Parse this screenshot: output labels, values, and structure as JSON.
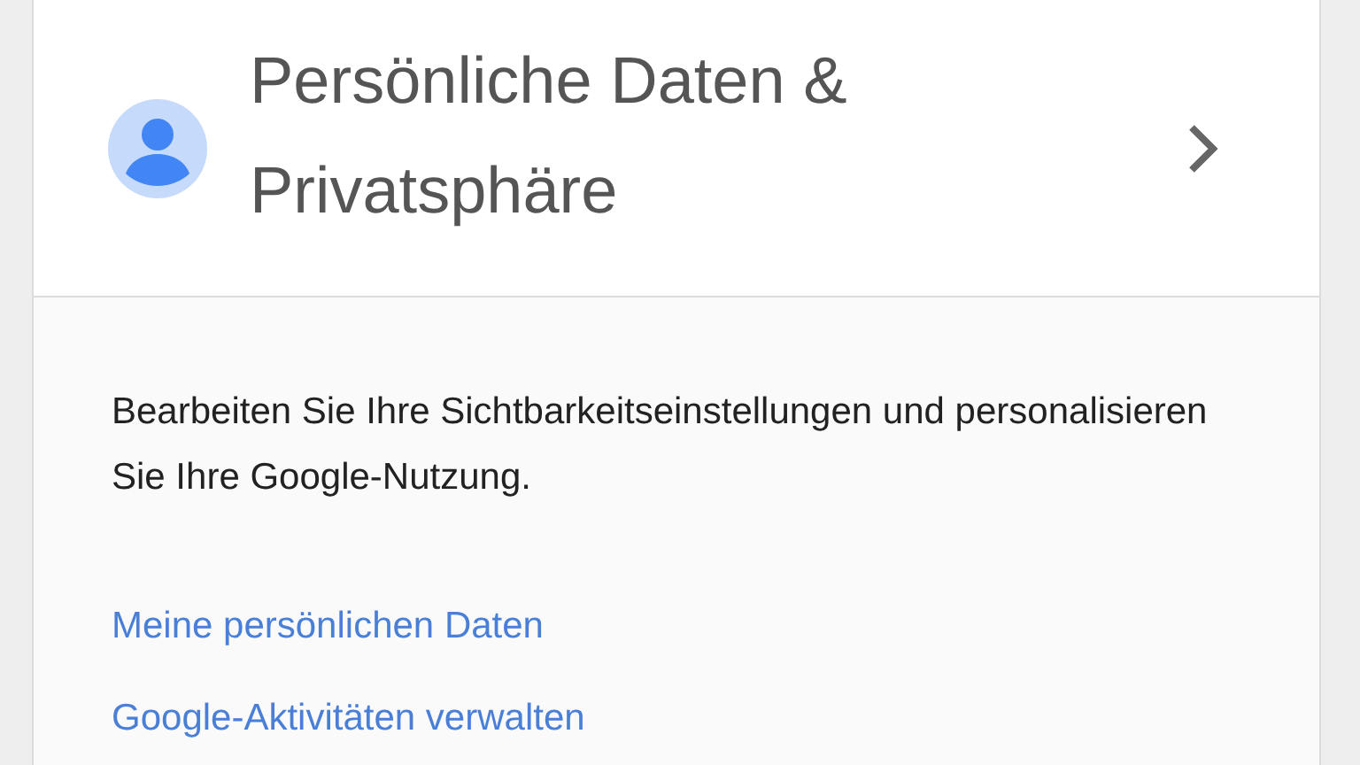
{
  "card": {
    "title": "Persönliche Daten & Privatsphäre",
    "description": "Bearbeiten Sie Ihre Sichtbarkeitseinstellungen und personalisieren Sie Ihre Google-Nutzung.",
    "links": [
      "Meine persönlichen Daten",
      "Google-Aktivitäten verwalten"
    ]
  }
}
